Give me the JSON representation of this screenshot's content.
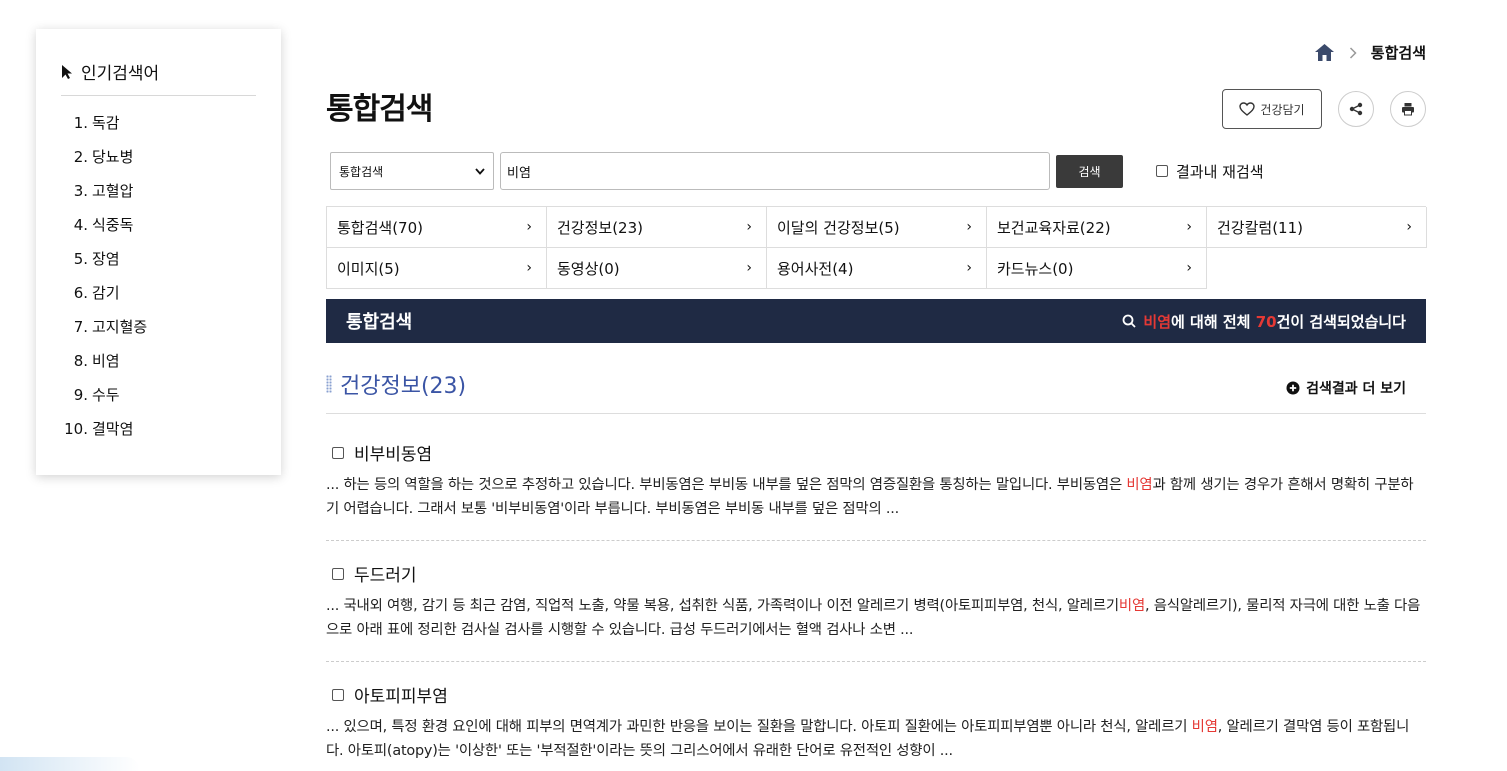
{
  "popular": {
    "title": "인기검색어",
    "items": [
      {
        "num": "1.",
        "label": "독감"
      },
      {
        "num": "2.",
        "label": "당뇨병"
      },
      {
        "num": "3.",
        "label": "고혈압"
      },
      {
        "num": "4.",
        "label": "식중독"
      },
      {
        "num": "5.",
        "label": "장염"
      },
      {
        "num": "6.",
        "label": "감기"
      },
      {
        "num": "7.",
        "label": "고지혈증"
      },
      {
        "num": "8.",
        "label": "비염"
      },
      {
        "num": "9.",
        "label": "수두"
      },
      {
        "num": "10.",
        "label": "결막염"
      }
    ]
  },
  "breadcrumb": {
    "current": "통합검색"
  },
  "page_title": "통합검색",
  "tools": {
    "keep_label": "건강담기"
  },
  "search": {
    "scope_selected": "통합검색",
    "query": "비염",
    "button": "검색",
    "re_search_label": "결과내 재검색"
  },
  "categories": [
    {
      "label": "통합검색(70)"
    },
    {
      "label": "건강정보(23)"
    },
    {
      "label": "이달의 건강정보(5)"
    },
    {
      "label": "보건교육자료(22)"
    },
    {
      "label": "건강칼럼(11)"
    },
    {
      "label": "이미지(5)"
    },
    {
      "label": "동영상(0)"
    },
    {
      "label": "용어사전(4)"
    },
    {
      "label": "카드뉴스(0)"
    }
  ],
  "result_bar": {
    "label": "통합검색",
    "keyword": "비염",
    "mid": "에 대해 전체 ",
    "count": "70",
    "tail": "건이 검색되었습니다"
  },
  "section": {
    "title": "건강정보(23)",
    "more": "검색결과 더 보기"
  },
  "items": [
    {
      "title": "비부비동염",
      "desc_before": "... 하는 등의 역할을 하는 것으로 추정하고 있습니다. 부비동염은 부비동 내부를 덮은 점막의 염증질환을 통칭하는 말입니다. 부비동염은 ",
      "highlight": "비염",
      "desc_after": "과 함께 생기는 경우가 흔해서 명확히 구분하기 어렵습니다. 그래서 보통 '비부비동염'이라 부릅니다. 부비동염은 부비동 내부를 덮은 점막의 ..."
    },
    {
      "title": "두드러기",
      "desc_before": "... 국내외 여행, 감기 등 최근 감염, 직업적 노출, 약물 복용, 섭취한 식품, 가족력이나 이전 알레르기 병력(아토피피부염, 천식, 알레르기",
      "highlight": "비염",
      "desc_after": ", 음식알레르기), 물리적 자극에 대한 노출 다음으로 아래 표에 정리한 검사실 검사를 시행할 수 있습니다. 급성 두드러기에서는 혈액 검사나 소변 ..."
    },
    {
      "title": "아토피피부염",
      "desc_before": "... 있으며, 특정 환경 요인에 대해 피부의 면역계가 과민한 반응을 보이는 질환을 말합니다. 아토피 질환에는 아토피피부염뿐 아니라 천식, 알레르기 ",
      "highlight": "비염",
      "desc_after": ", 알레르기 결막염 등이 포함됩니다. 아토피(atopy)는 '이상한' 또는 '부적절한'이라는 뜻의 그리스어에서 유래한 단어로 유전적인 성향이 ..."
    }
  ]
}
